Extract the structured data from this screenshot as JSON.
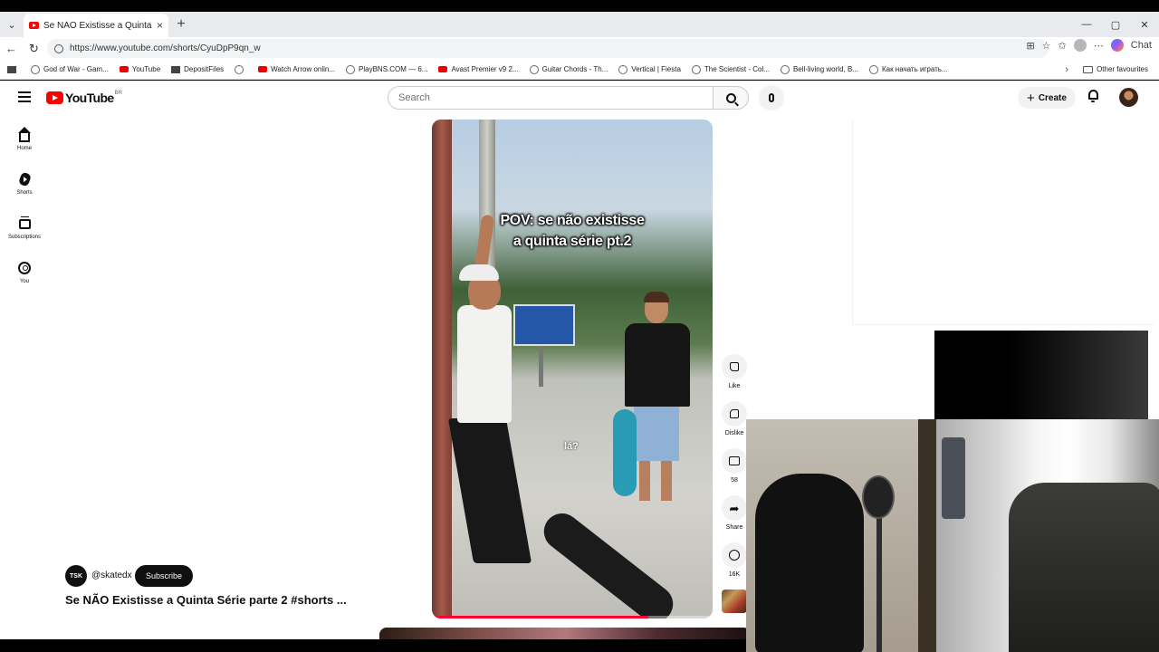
{
  "browser": {
    "tab_title": "Se NÃO Existisse a Quinta Série pa",
    "tab_close": "×",
    "new_tab": "+",
    "window_controls": [
      "—",
      "▢",
      "✕"
    ],
    "url": "https://www.youtube.com/shorts/CyuDpP9qn_w",
    "chat_label": "Chat"
  },
  "bookmarks": [
    {
      "label": "God of War - Gam...",
      "icon": "globe-icon"
    },
    {
      "label": "YouTube",
      "icon": "youtube-icon"
    },
    {
      "label": "DepositFiles",
      "icon": "depositfiles-icon"
    },
    {
      "label": "",
      "icon": "globe-icon"
    },
    {
      "label": "Watch Arrow onlin...",
      "icon": "video-icon"
    },
    {
      "label": "PlayBNS.COM — 6...",
      "icon": "globe-icon"
    },
    {
      "label": "Avast Premier v9 2...",
      "icon": "youtube-icon"
    },
    {
      "label": "Guitar Chords - Th...",
      "icon": "globe-icon"
    },
    {
      "label": "Vertical | Fiesta",
      "icon": "globe-icon"
    },
    {
      "label": "The Scientist - Col...",
      "icon": "globe-icon"
    },
    {
      "label": "Bell-living world, B...",
      "icon": "globe-icon"
    },
    {
      "label": "Как начать играть...",
      "icon": "globe-icon"
    }
  ],
  "bookmarks_more": "›",
  "other_favourites": "Other favourites",
  "youtube": {
    "logo_text": "YouTube",
    "country_code": "BR",
    "search_placeholder": "Search",
    "create_label": "Create",
    "sidebar": [
      {
        "label": "Home",
        "icon": "home-icon"
      },
      {
        "label": "Shorts",
        "icon": "shorts-icon"
      },
      {
        "label": "Subscriptions",
        "icon": "subscriptions-icon"
      },
      {
        "label": "You",
        "icon": "you-icon"
      }
    ]
  },
  "short": {
    "caption_line1": "POV: se não existisse",
    "caption_line2": "a quinta série pt.2",
    "overlay_text": "lá?",
    "progress_fraction": 0.77,
    "channel_avatar_text": "TSK",
    "channel": "@skatedx",
    "subscribe_label": "Subscribe",
    "title": "Se NÃO Existisse a Quinta Série parte 2 #shorts ..."
  },
  "actions": {
    "like_label": "Like",
    "dislike_label": "Dislike",
    "comments_count": "58",
    "share_label": "Share",
    "remix_count": "16K"
  },
  "colors": {
    "yt_red": "#ff0000",
    "progress": "#ff0033",
    "subscribe_bg": "#0f0f0f"
  }
}
